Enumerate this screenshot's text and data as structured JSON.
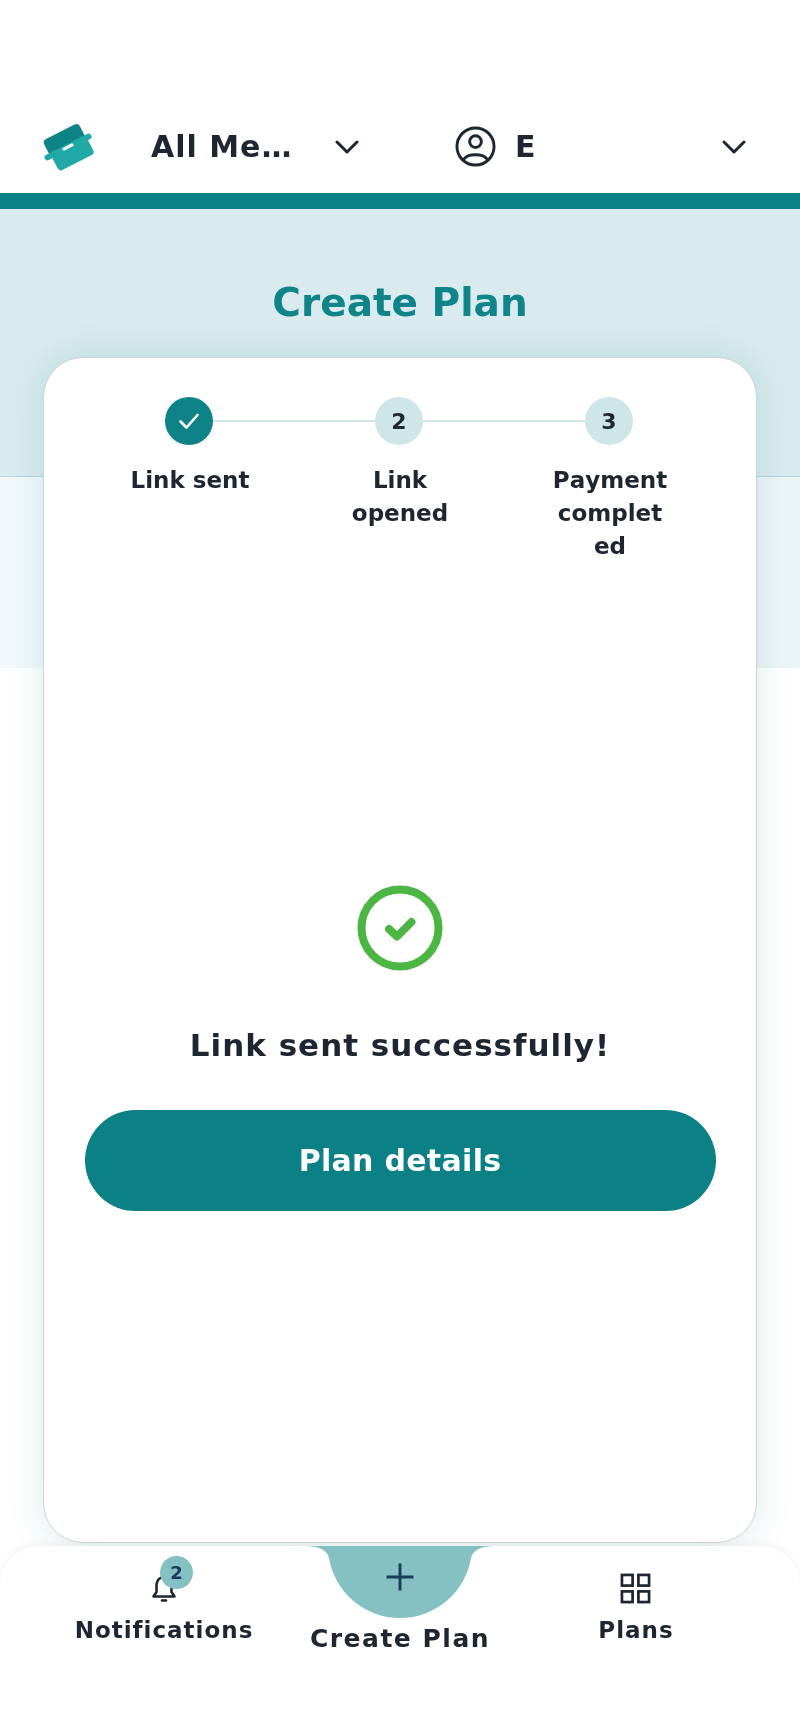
{
  "header": {
    "scope_dropdown": {
      "value": "All Me…"
    },
    "user_menu": {
      "value": "E"
    }
  },
  "title": "Create Plan",
  "stepper": {
    "steps": [
      {
        "label": "Link sent",
        "completed": true
      },
      {
        "label": "Link opened",
        "number": "2",
        "completed": false
      },
      {
        "label": "Payment completed",
        "number": "3",
        "completed": false
      }
    ]
  },
  "result": {
    "message": "Link sent successfully!",
    "button": "Plan details"
  },
  "bottom_nav": {
    "items": [
      {
        "kind": "tab",
        "label": "Notifications",
        "badge": "2"
      },
      {
        "kind": "fab",
        "label": "Create Plan"
      },
      {
        "kind": "tab",
        "label": "Plans"
      }
    ]
  }
}
